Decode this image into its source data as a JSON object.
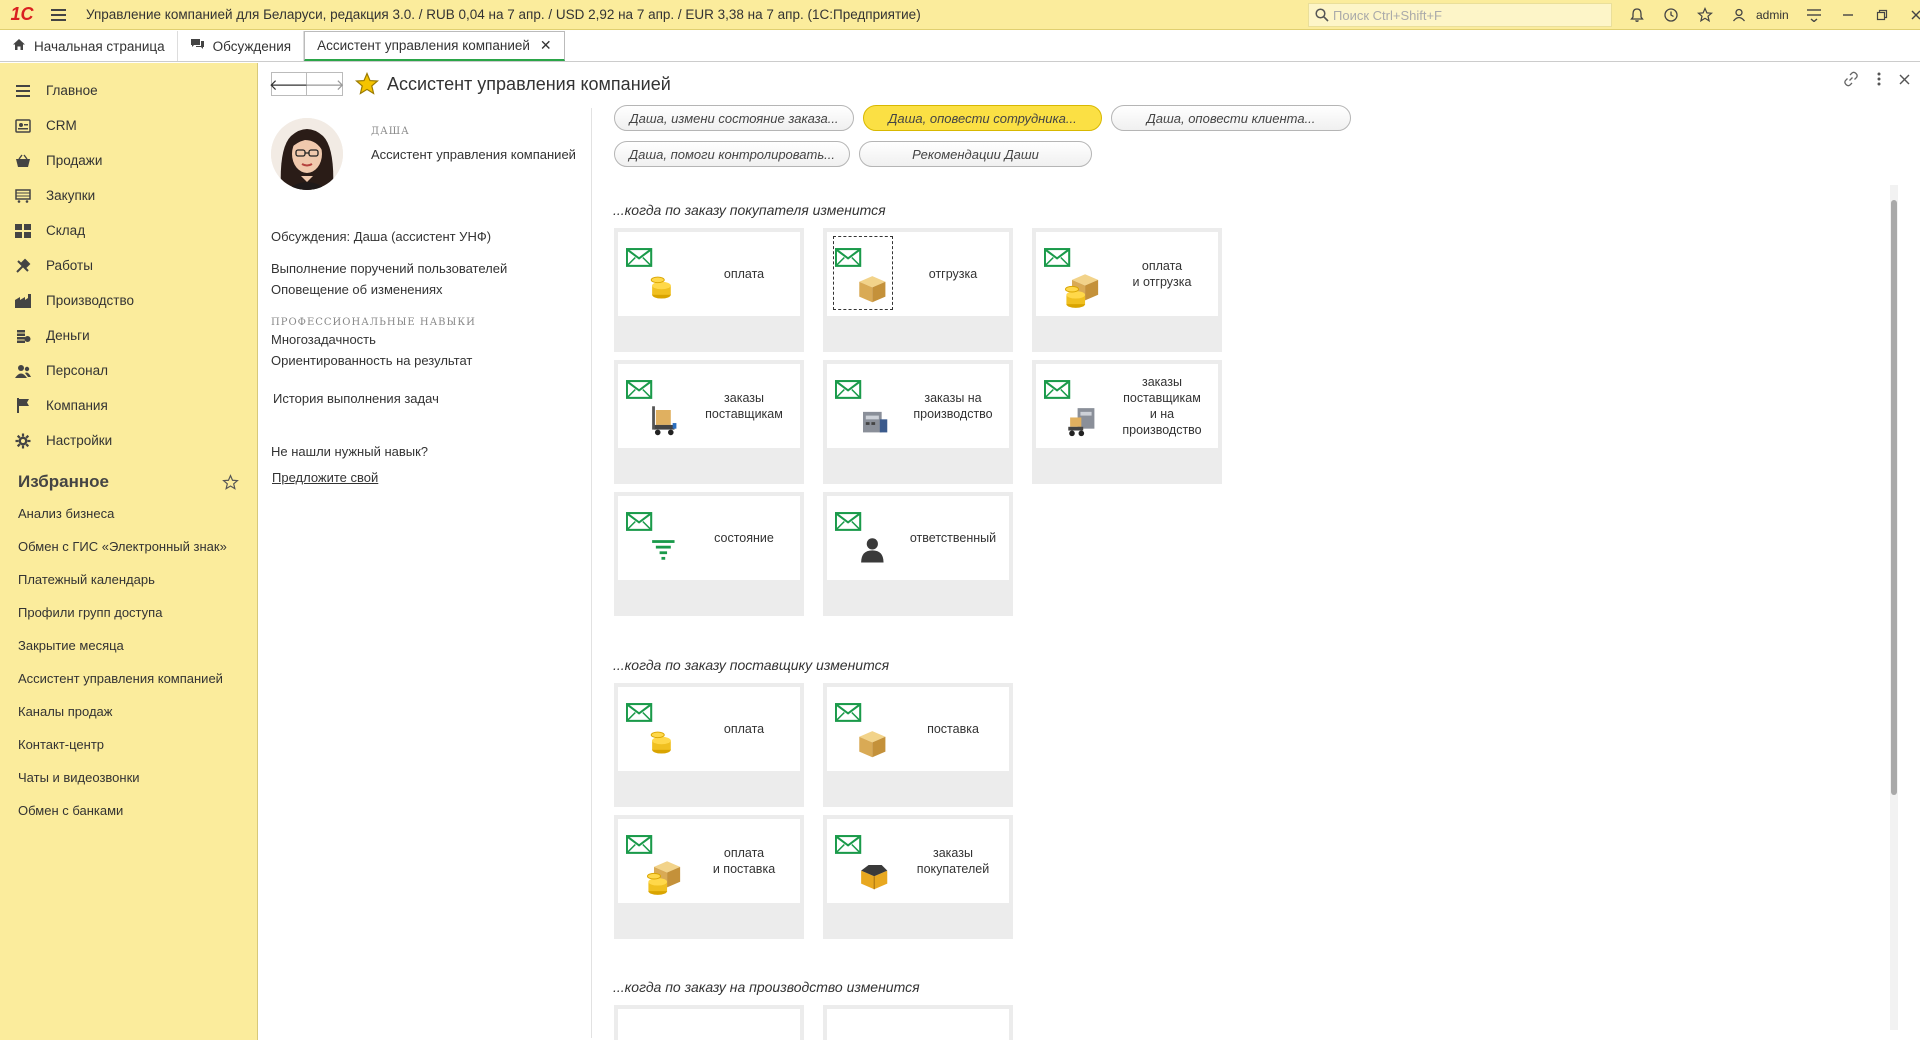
{
  "titlebar": {
    "logo": "1С",
    "title": "Управление компанией для Беларуси, редакция 3.0.  / RUB 0,04 на 7 апр. / USD 2,92 на 7 апр. / EUR 3,38 на 7 апр.  (1С:Предприятие)",
    "search_placeholder": "Поиск Ctrl+Shift+F",
    "user": "admin"
  },
  "tabs": [
    {
      "label": "Начальная страница",
      "icon": "home-icon"
    },
    {
      "label": "Обсуждения",
      "icon": "chat-icon"
    },
    {
      "label": "Ассистент управления компанией",
      "icon": "",
      "active": true
    }
  ],
  "sidebar": {
    "items": [
      {
        "label": "Главное",
        "icon": "list-icon"
      },
      {
        "label": "CRM",
        "icon": "crm-icon"
      },
      {
        "label": "Продажи",
        "icon": "basket-icon"
      },
      {
        "label": "Закупки",
        "icon": "cart-icon"
      },
      {
        "label": "Склад",
        "icon": "warehouse-icon"
      },
      {
        "label": "Работы",
        "icon": "tools-icon"
      },
      {
        "label": "Производство",
        "icon": "factory-icon"
      },
      {
        "label": "Деньги",
        "icon": "coins-icon"
      },
      {
        "label": "Персонал",
        "icon": "people-icon"
      },
      {
        "label": "Компания",
        "icon": "flag-icon"
      },
      {
        "label": "Настройки",
        "icon": "gear-icon"
      }
    ],
    "favorites_title": "Избранное",
    "favorites": [
      "Анализ бизнеса",
      "Обмен с ГИС «Электронный знак»",
      "Платежный календарь",
      "Профили групп доступа",
      "Закрытие месяца",
      "Ассистент управления компанией",
      "Каналы продаж",
      "Контакт-центр",
      "Чаты и видеозвонки",
      "Обмен с банками"
    ]
  },
  "form": {
    "title": "Ассистент управления компанией"
  },
  "assistant": {
    "name": "ДАША",
    "role": "Ассистент управления компанией",
    "discussions": "Обсуждения: Даша (ассистент УНФ)",
    "duties": [
      "Выполнение поручений пользователей",
      "Оповещение об изменениях"
    ],
    "skills_title": "ПРОФЕССИОНАЛЬНЫЕ НАВЫКИ",
    "skills": [
      "Многозадачность",
      "Ориентированность на результат"
    ],
    "history": "История выполнения задач",
    "not_found": "Не нашли нужный навык?",
    "suggest": "Предложите свой"
  },
  "buttons": [
    "Даша, измени состояние заказа...",
    "Даша, оповести сотрудника...",
    "Даша, оповести клиента...",
    "Даша, помоги контролировать...",
    "Рекомендации Даши"
  ],
  "sections": [
    {
      "title": "...когда по заказу покупателя изменится",
      "tiles": [
        {
          "label": "оплата",
          "icon": "coins-icon"
        },
        {
          "label": "отгрузка",
          "icon": "box-icon"
        },
        {
          "label": "оплата\nи отгрузка",
          "icon": "box-coins-icon"
        },
        {
          "label": "заказы\nпоставщикам",
          "icon": "pallet-truck-icon"
        },
        {
          "label": "заказы на\nпроизводство",
          "icon": "machine-icon"
        },
        {
          "label": "заказы\nпоставщикам\nи на\nпроизводство",
          "icon": "truck-machine-icon"
        },
        {
          "label": "состояние",
          "icon": "filter-icon"
        },
        {
          "label": "ответственный",
          "icon": "person-icon"
        }
      ]
    },
    {
      "title": "...когда по заказу поставщику изменится",
      "tiles": [
        {
          "label": "оплата",
          "icon": "coins-icon"
        },
        {
          "label": "поставка",
          "icon": "box-icon"
        },
        {
          "label": "оплата\nи поставка",
          "icon": "box-coins-icon"
        },
        {
          "label": "заказы\nпокупателей",
          "icon": "open-box-icon"
        }
      ]
    },
    {
      "title": "...когда по заказу на производство изменится",
      "tiles": []
    }
  ]
}
